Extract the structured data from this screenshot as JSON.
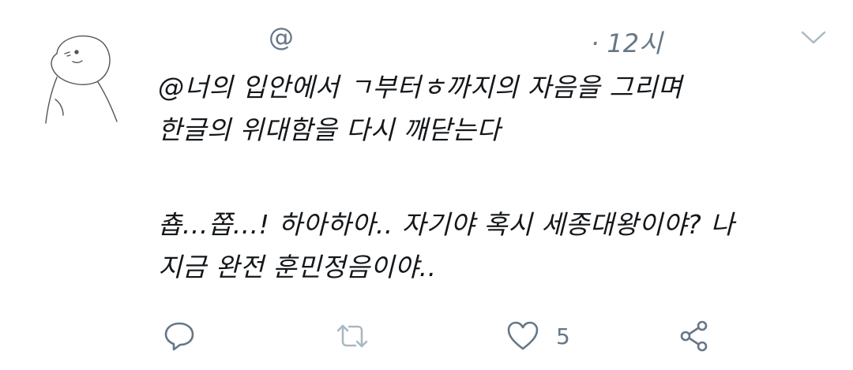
{
  "tweet": {
    "handle": "@",
    "time": "· 12시",
    "lines": [
      "@너의 입안에서 ㄱ부터ㅎ까지의 자음을 그리며",
      "한글의 위대함을 다시 깨닫는다",
      "춉...쫍...! 하아하아.. 자기야 혹시 세종대왕이야? 나",
      "지금 완전 훈민정음이야.."
    ],
    "actions": {
      "reply_icon": "reply-icon",
      "retweet_icon": "retweet-icon",
      "like_icon": "heart-icon",
      "like_count": "5",
      "share_icon": "share-icon"
    }
  },
  "colors": {
    "text": "#14171a",
    "muted": "#657786",
    "icon": "#657786",
    "icon_light": "#aab8c2"
  }
}
